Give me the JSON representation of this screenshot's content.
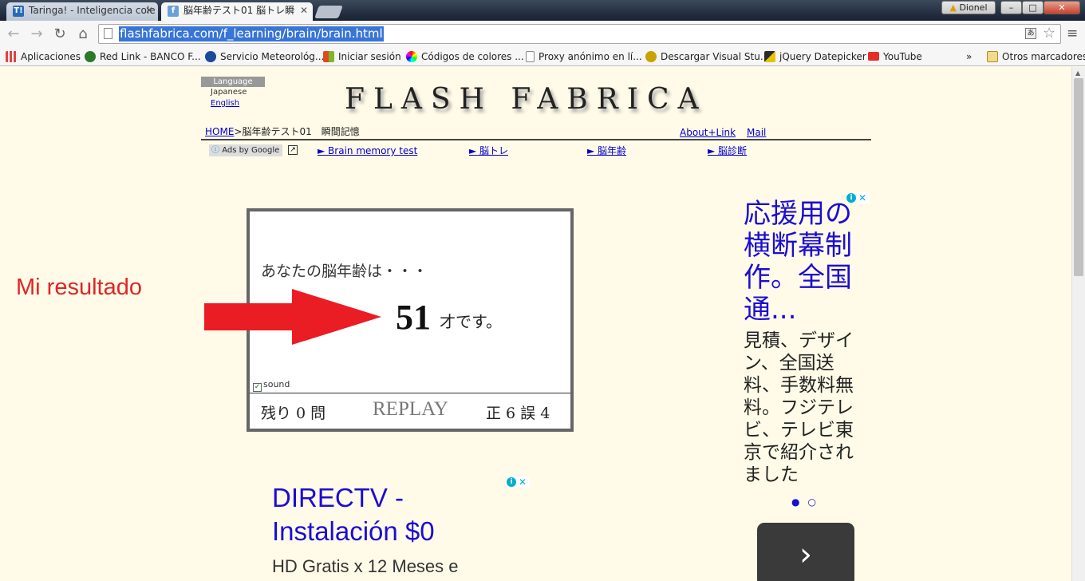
{
  "browser": {
    "tabs": [
      {
        "label": "Taringa! - Inteligencia cole",
        "icon": "taringa-icon",
        "favicon_text": "T!",
        "favicon_color": "#2a6ab8",
        "active": false
      },
      {
        "label": "脳年齢テスト01 脳トレ瞬",
        "icon": "flash-fabrica-icon",
        "favicon_text": "f",
        "favicon_color": "#6aa0d8",
        "active": true
      }
    ],
    "profile_name": "Dionel",
    "window_buttons": {
      "minimize": "–",
      "maximize": "□",
      "close": "✕"
    },
    "url": "flashfabrica.com/f_learning/brain/brain.html",
    "nav": {
      "back": "←",
      "forward": "→",
      "reload": "↻",
      "home": "⌂"
    },
    "menu_glyph": "≡",
    "bookmarks": [
      {
        "label": "Aplicaciones",
        "icon": "apps-grid-icon",
        "color": "#d44"
      },
      {
        "label": "Red Link - BANCO F...",
        "icon": "redlink-icon",
        "color": "#2a7a2a"
      },
      {
        "label": "Servicio Meteorológ...",
        "icon": "weather-icon",
        "color": "#1a4a9a"
      },
      {
        "label": "Iniciar sesión",
        "icon": "windows-icon",
        "color": "#e04a1a"
      },
      {
        "label": "Códigos de colores ...",
        "icon": "color-wheel-icon",
        "color": "#c0c"
      },
      {
        "label": "Proxy anónimo en lí...",
        "icon": "page-icon",
        "color": "#fff"
      },
      {
        "label": "Descargar Visual Stu...",
        "icon": "bee-icon",
        "color": "#c9a200"
      },
      {
        "label": "jQuery Datepicker",
        "icon": "jquery-icon",
        "color": "#2a2a2a"
      },
      {
        "label": "YouTube",
        "icon": "youtube-icon",
        "color": "#e52d27"
      }
    ],
    "bookmarks_more": "»",
    "other_bookmarks": "Otros marcadores"
  },
  "page": {
    "language": {
      "header": "Language",
      "options": [
        "Japanese",
        "English"
      ]
    },
    "logo": "FLASH FABRICA",
    "breadcrumb": {
      "home": "HOME",
      "rest": ">脳年齢テスト01　瞬間記憶"
    },
    "header_links": {
      "about": "About+Link",
      "mail": "Mail"
    },
    "ads_by_google": "Ads by Google",
    "ad_nav": [
      "► Brain memory test",
      "► 脳トレ",
      "► 脳年齢",
      "► 脳診断"
    ],
    "annotation": "Mi resultado",
    "game": {
      "question": "あなたの脳年齢は・・・",
      "age": "51",
      "age_suffix": "才です。",
      "sound_label": "sound",
      "remaining": "残り 0 問",
      "replay": "REPLAY",
      "score": "正 6 誤 4"
    },
    "ad_right": {
      "title": "応援用の横断幕制作。全国通...",
      "body": "見積、デザイン、全国送料、手数料無料。フジテレビ、テレビ東京で紹介されました",
      "dots": "●○",
      "next": "›"
    },
    "ad_bottom": {
      "title_line1": "DIRECTV -",
      "title_line2": "Instalación $0",
      "body": "HD Gratis x 12 Meses e"
    }
  }
}
